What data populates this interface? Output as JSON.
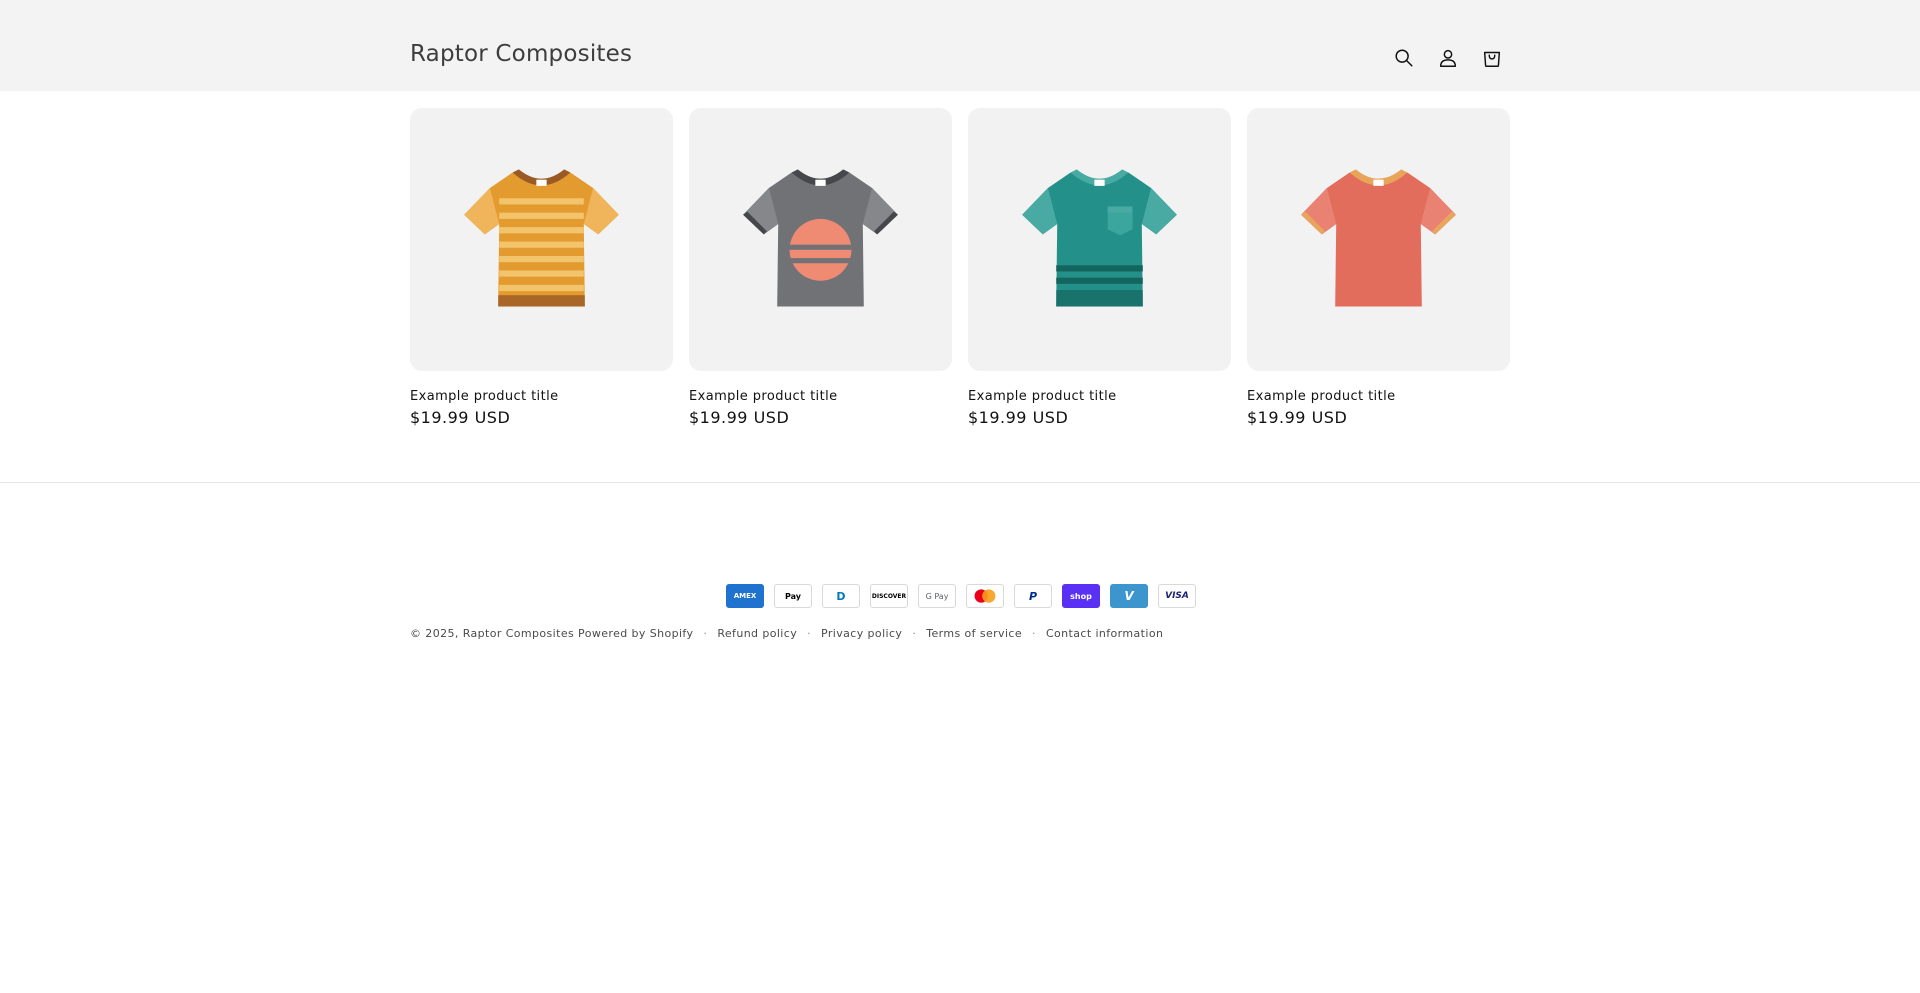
{
  "header": {
    "logo": "Raptor Composites",
    "icons": [
      "search-icon",
      "account-icon",
      "cart-icon"
    ]
  },
  "products": [
    {
      "title": "Example product title",
      "price": "$19.99 USD",
      "colors": {
        "body": "#e39b2f",
        "stripe": "#f2c46c",
        "collar": "#9a5a26",
        "sleeve_trim": "#f0b45a"
      }
    },
    {
      "title": "Example product title",
      "price": "$19.99 USD",
      "colors": {
        "body": "#707276",
        "accent": "#ef8a73",
        "collar": "#45474a",
        "sleeve": "#85878b"
      }
    },
    {
      "title": "Example product title",
      "price": "$19.99 USD",
      "colors": {
        "body": "#23918a",
        "stripe": "#15655f",
        "collar": "#48aaa2",
        "pocket": "#3aa69d"
      }
    },
    {
      "title": "Example product title",
      "price": "$19.99 USD",
      "colors": {
        "body": "#e26d5c",
        "collar": "#e8a55a",
        "sleeve_trim": "#eaa55c"
      }
    }
  ],
  "payments": [
    {
      "name": "American Express",
      "label": "AMEX",
      "bg": "#1f72cd",
      "fg": "#ffffff"
    },
    {
      "name": "Apple Pay",
      "label": " Pay",
      "bg": "#ffffff",
      "fg": "#000000"
    },
    {
      "name": "Diners Club",
      "label": "D",
      "bg": "#ffffff",
      "fg": "#0079be"
    },
    {
      "name": "Discover",
      "label": "DISCOVER",
      "bg": "#ffffff",
      "fg": "#000000"
    },
    {
      "name": "Google Pay",
      "label": "G Pay",
      "bg": "#ffffff",
      "fg": "#5f6368"
    },
    {
      "name": "Mastercard",
      "label": "",
      "bg": "#ffffff",
      "fg": "#000000"
    },
    {
      "name": "PayPal",
      "label": "P",
      "bg": "#ffffff",
      "fg": "#003087"
    },
    {
      "name": "Shop Pay",
      "label": "shop",
      "bg": "#5a31f4",
      "fg": "#ffffff"
    },
    {
      "name": "Venmo",
      "label": "V",
      "bg": "#3d95ce",
      "fg": "#ffffff"
    },
    {
      "name": "Visa",
      "label": "VISA",
      "bg": "#ffffff",
      "fg": "#1a1f71"
    }
  ],
  "footer": {
    "copyright": "© 2025,",
    "store_link": "Raptor Composites",
    "powered": "Powered by Shopify",
    "links": [
      "Refund policy",
      "Privacy policy",
      "Terms of service",
      "Contact information"
    ]
  }
}
